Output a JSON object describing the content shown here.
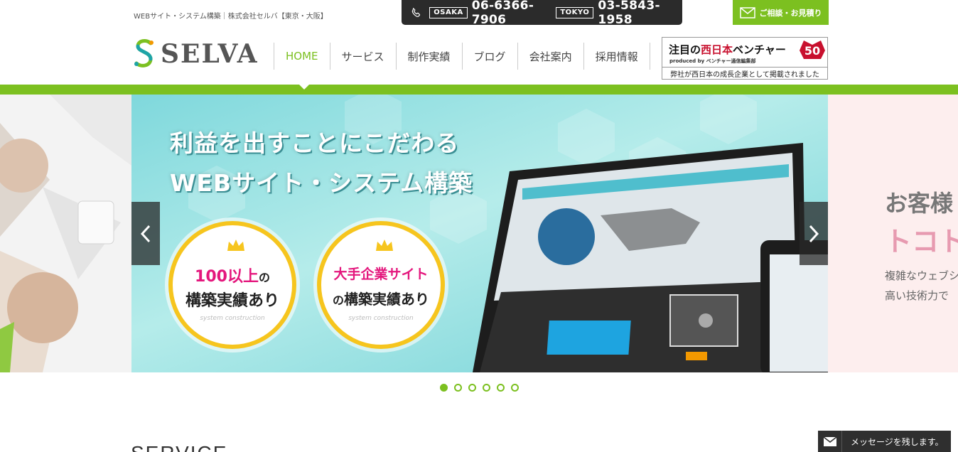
{
  "header": {
    "tagline": "WEBサイト・システム構築｜株式会社セルバ【東京・大阪】",
    "phones": [
      {
        "city": "OSAKA",
        "number": "06-6366-7906"
      },
      {
        "city": "TOKYO",
        "number": "03-5843-1958"
      }
    ],
    "consult_label": "ご相談・お見積り",
    "logo_text": "SELVA",
    "brand_colors": {
      "green": "#7cc020",
      "dark": "#2b2b2b"
    }
  },
  "nav": {
    "items": [
      "HOME",
      "サービス",
      "制作実績",
      "ブログ",
      "会社案内",
      "採用情報"
    ],
    "active": "HOME"
  },
  "venture": {
    "title_prefix": "注目の",
    "title_red": "西日本",
    "title_suffix": "ベンチャー",
    "number": "50",
    "produced_by": "produced by ベンチャー通信編集部",
    "footer": "弊社が西日本の成長企業として掲載されました"
  },
  "slider": {
    "headline_1": "利益を出すことにこだわる",
    "headline_2": "WEBサイト・システム構築",
    "badge_1": {
      "line1_pink": "100以上",
      "line1_suffix": "の",
      "line2": "構築実績あり",
      "foot": "system construction"
    },
    "badge_2": {
      "line1_pink": "大手企業サイト",
      "line2_prefix": "の",
      "line2": "構築実績あり",
      "foot": "system construction"
    },
    "right_slide": {
      "line1": "お客様",
      "line2": "トコト",
      "line3": "複雑なウェブシ",
      "line4": "高い技術力で"
    },
    "dot_count": 6,
    "active_dot": 0
  },
  "section": {
    "title": "SERVICE"
  },
  "chat": {
    "label": "メッセージを残します。"
  }
}
